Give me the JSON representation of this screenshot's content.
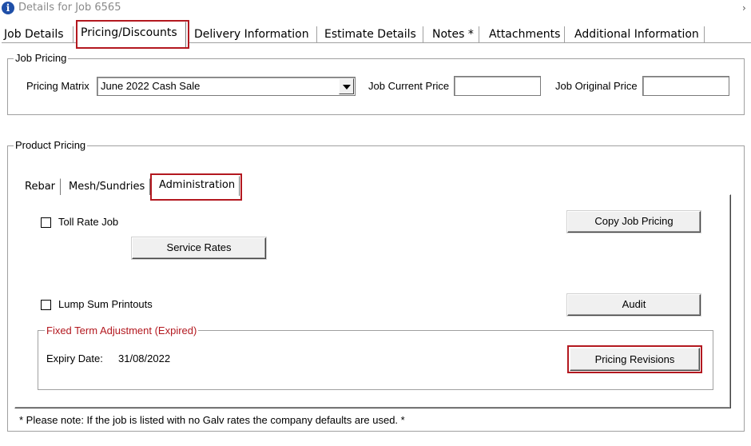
{
  "window": {
    "title": "Details for Job 6565",
    "close_glyph": "›"
  },
  "top_tabs": [
    {
      "label": "Job Details",
      "selected": false
    },
    {
      "label": "Pricing/Discounts",
      "selected": true
    },
    {
      "label": "Delivery Information",
      "selected": false
    },
    {
      "label": "Estimate Details",
      "selected": false
    },
    {
      "label": "Notes *",
      "selected": false
    },
    {
      "label": "Attachments",
      "selected": false
    },
    {
      "label": "Additional Information",
      "selected": false
    }
  ],
  "job_pricing": {
    "legend": "Job Pricing",
    "matrix_label": "Pricing Matrix",
    "matrix_value": "June 2022 Cash Sale",
    "current_price_label": "Job Current Price",
    "current_price_value": "",
    "original_price_label": "Job Original Price",
    "original_price_value": ""
  },
  "product_pricing": {
    "legend": "Product Pricing",
    "tabs": [
      {
        "label": "Rebar",
        "selected": false
      },
      {
        "label": "Mesh/Sundries",
        "selected": false
      },
      {
        "label": "Administration",
        "selected": true
      }
    ],
    "toll_rate_label": "Toll Rate Job",
    "toll_rate_checked": false,
    "service_rates_button": "Service Rates",
    "copy_job_pricing_button": "Copy Job Pricing",
    "lump_sum_label": "Lump Sum Printouts",
    "lump_sum_checked": false,
    "audit_button": "Audit",
    "fixed_term": {
      "legend": "Fixed Term Adjustment (Expired)",
      "expiry_label": "Expiry Date:",
      "expiry_value": "31/08/2022",
      "revisions_button": "Pricing Revisions"
    }
  },
  "note": "* Please note: If the job is listed with no Galv rates the company defaults are used. *",
  "colors": {
    "highlight": "#b3181f",
    "icon_blue": "#1f4fa8",
    "expired_text": "#b3181f"
  },
  "icons": {
    "title_icon": "info-icon",
    "dropdown": "chevron-down-icon"
  }
}
